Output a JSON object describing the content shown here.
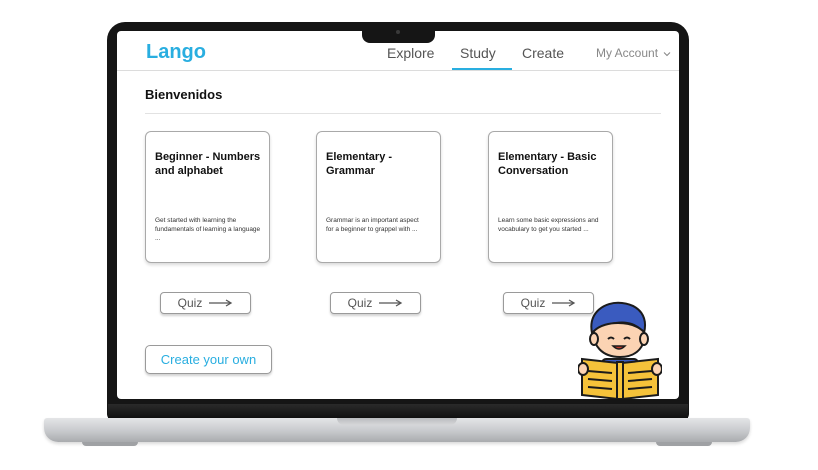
{
  "app": {
    "logo": "Lango"
  },
  "nav": {
    "items": [
      {
        "label": "Explore"
      },
      {
        "label": "Study",
        "active": true
      },
      {
        "label": "Create"
      }
    ],
    "account": {
      "label": "My Account",
      "icon": "chevron-down-icon"
    }
  },
  "page": {
    "title": "Bienvenidos"
  },
  "cards": [
    {
      "title": "Beginner - Numbers and alphabet",
      "description": "Get started with learning the fundamentals of learning a language ...",
      "quiz_label": "Quiz"
    },
    {
      "title": "Elementary - Grammar",
      "description": "Grammar is an important aspect for a beginner to grappel with ...",
      "quiz_label": "Quiz"
    },
    {
      "title": "Elementary - Basic Conversation",
      "description": "Learn some basic expressions and vocabulary to get you started ...",
      "quiz_label": "Quiz"
    }
  ],
  "actions": {
    "create_own": "Create your own"
  },
  "colors": {
    "accent": "#29aee0",
    "book": "#f5c23a",
    "hair": "#3a5bbf"
  },
  "icons": {
    "quiz_arrow": "arrow-right-icon",
    "illustration": "boy-reading-book-illustration"
  }
}
